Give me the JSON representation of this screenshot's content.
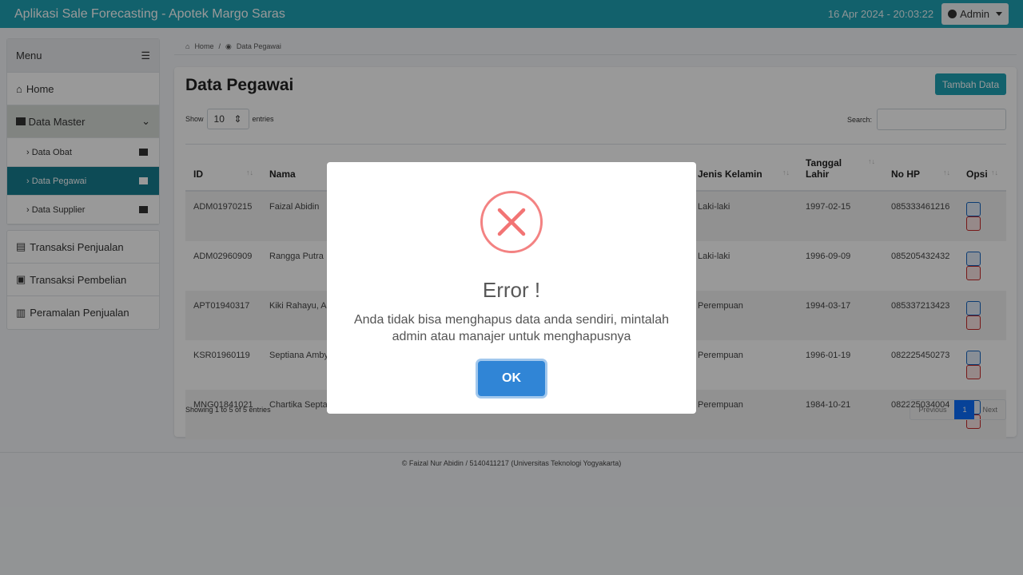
{
  "header": {
    "title": "Aplikasi Sale Forecasting - Apotek Margo Saras",
    "datetime": "16 Apr 2024 - 20:03:22",
    "user": "Admin"
  },
  "sidebar": {
    "menu_label": "Menu",
    "home": "Home",
    "data_master": "Data Master",
    "sub_items": [
      "Data Obat",
      "Data Pegawai",
      "Data Supplier"
    ],
    "other_items": [
      "Transaksi Penjualan",
      "Transaksi Pembelian",
      "Peramalan Penjualan"
    ]
  },
  "breadcrumb": {
    "home": "Home",
    "current": "Data Pegawai"
  },
  "page": {
    "title": "Data Pegawai",
    "add_button": "Tambah Data",
    "show": "Show",
    "entries_value": "10",
    "entries": "entries",
    "search": "Search:",
    "info": "Showing 1 to 5 of 5 entries",
    "prev": "Previous",
    "page_num": "1",
    "next": "Next"
  },
  "table": {
    "headers": [
      "ID",
      "Nama",
      "Jenis Kelamin",
      "Tanggal Lahir",
      "No HP",
      "Opsi"
    ],
    "rows": [
      [
        "ADM01970215",
        "Faizal Abidin",
        "Laki-laki",
        "1997-02-15",
        "085333461216"
      ],
      [
        "ADM02960909",
        "Rangga Putra",
        "Laki-laki",
        "1996-09-09",
        "085205432432"
      ],
      [
        "APT01940317",
        "Kiki Rahayu, A.",
        "Perempuan",
        "1994-03-17",
        "085337213423"
      ],
      [
        "KSR01960119",
        "Septiana Amby",
        "Perempuan",
        "1996-01-19",
        "082225450273"
      ],
      [
        "MNG01841021",
        "Chartika Septa Apt.",
        "Perempuan",
        "1984-10-21",
        "082225034004"
      ]
    ]
  },
  "footer": "Faizal Nur Abidin / 5140411217 (Universitas Teknologi Yogyakarta)",
  "modal": {
    "title": "Error !",
    "message": "Anda tidak bisa menghapus data anda sendiri, mintalah admin atau manajer untuk menghapusnya",
    "ok": "OK"
  }
}
